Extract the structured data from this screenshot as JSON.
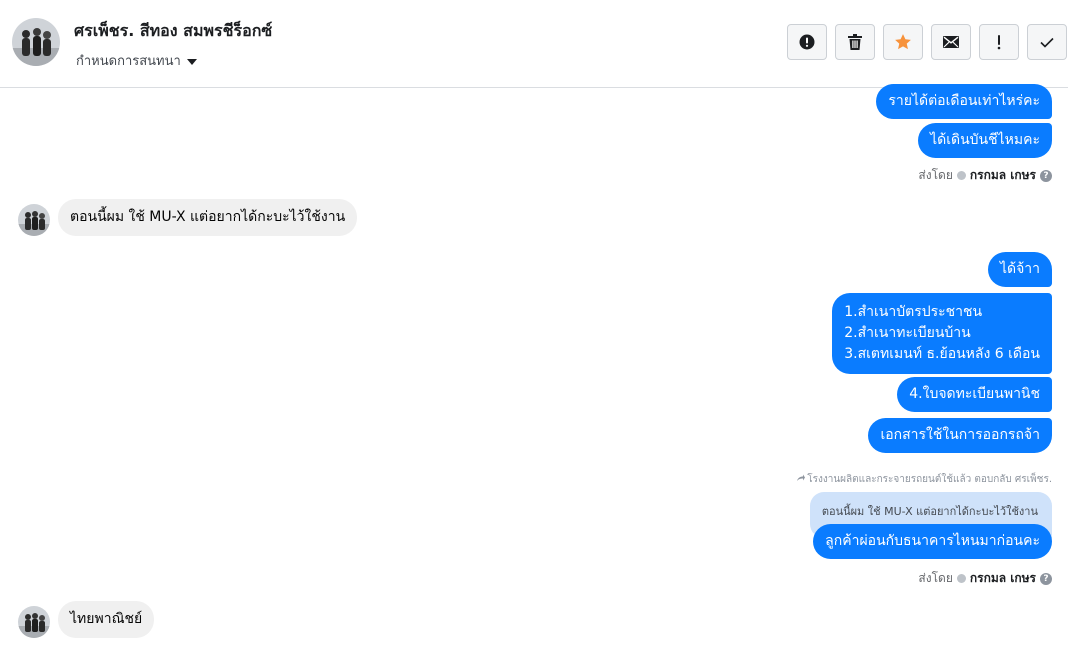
{
  "header": {
    "contact_name": "ศรเพ็ชร. สีทอง สมพรชีร็อกซ์",
    "assign_label": "กำหนดการสนทนา"
  },
  "toolbar": {
    "buttons": [
      {
        "icon": "alert-circle-icon"
      },
      {
        "icon": "trash-icon"
      },
      {
        "icon": "star-icon",
        "color": "#f7923b"
      },
      {
        "icon": "mail-icon"
      },
      {
        "icon": "exclamation-icon"
      },
      {
        "icon": "check-icon"
      }
    ]
  },
  "messages": {
    "m1": "รายได้ต่อเดือนเท่าไหร่คะ",
    "m2": "ได้เดินบันชีไหมคะ",
    "m3": "ตอนนี้ผม ใช้ MU-X  แต่อยากได้กะบะไว้ใช้งาน",
    "m4": "ได้จ้าา",
    "m5_l1": "1.สำเนาบัตรประชาชน",
    "m5_l2": "2.สำเนาทะเบียนบ้าน",
    "m5_l3": "3.สเตทเมนท์ ธ.ย้อนหลัง 6 เดือน",
    "m6": "4.ใบจดทะเบียนพานิช",
    "m7": "เอกสารใช้ในการออกรถจ้า",
    "replied_note": "โรงงานผลิตและกระจายรถยนต์ใช้แล้ว ตอบกลับ ศรเพ็ชร.",
    "quote": "ตอนนี้ผม ใช้ MU-X แต่อยากได้กะบะไว้ใช้งาน",
    "m8": "ลูกค้าผ่อนกับธนาคารไหนมาก่อนคะ",
    "m9": "ไทยพาณิชย์"
  },
  "sent_by": {
    "prefix": "ส่งโดย",
    "agent": "กรกมล เกษร",
    "help": "?"
  },
  "colors": {
    "outgoing_bubble": "#0a7cff",
    "incoming_bubble": "#f0f0f0",
    "quote_bubble": "#cfe2fa"
  }
}
